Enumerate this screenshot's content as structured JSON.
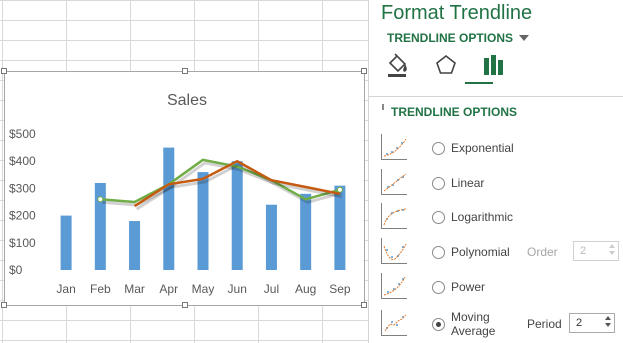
{
  "pane": {
    "title": "Format Trendline",
    "options_dropdown": "TRENDLINE OPTIONS",
    "section_header": "TRENDLINE OPTIONS",
    "icons": [
      "fill-line-icon",
      "effects-pentagon-icon",
      "trendline-options-bars-icon"
    ],
    "options": [
      {
        "name": "Exponential",
        "selected": false
      },
      {
        "name": "Linear",
        "selected": false
      },
      {
        "name": "Logarithmic",
        "selected": false
      },
      {
        "name": "Polynomial",
        "selected": false
      },
      {
        "name": "Power",
        "selected": false
      },
      {
        "name": "Moving Average",
        "line1": "Moving",
        "line2": "Average",
        "selected": true
      }
    ],
    "order_label": "Order",
    "order_value": "2",
    "period_label": "Period",
    "period_value": "2",
    "accent_color": "#217346"
  },
  "chart_data": {
    "type": "bar",
    "title": "Sales",
    "categories": [
      "Jan",
      "Feb",
      "Mar",
      "Apr",
      "May",
      "Jun",
      "Jul",
      "Aug",
      "Sep"
    ],
    "ylim": [
      0,
      500
    ],
    "yticks": [
      "$0",
      "$100",
      "$200",
      "$300",
      "$400",
      "$500"
    ],
    "grid": false,
    "series": [
      {
        "type": "bar",
        "values": [
          200,
          320,
          180,
          450,
          360,
          400,
          240,
          280,
          310
        ],
        "color": "#5b9bd5"
      },
      {
        "type": "line",
        "values": [
          null,
          260,
          250,
          315,
          405,
          380,
          330,
          260,
          295
        ],
        "color": "#70ad47"
      },
      {
        "type": "line",
        "values": [
          null,
          null,
          235,
          315,
          335,
          400,
          330,
          305,
          280
        ],
        "color": "#c55a11"
      }
    ]
  }
}
